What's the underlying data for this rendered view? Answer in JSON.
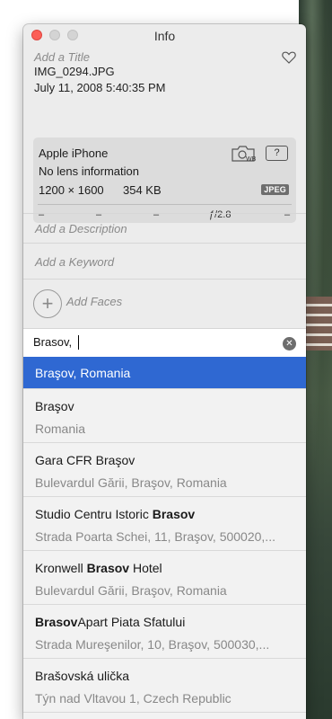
{
  "window": {
    "title": "Info"
  },
  "header": {
    "title_placeholder": "Add a Title",
    "filename": "IMG_0294.JPG",
    "datetime": "July 11, 2008   5:40:35 PM"
  },
  "camera": {
    "model": "Apple iPhone",
    "lens": "No lens information",
    "resolution": "1200 × 1600",
    "size": "354 KB",
    "format": "JPEG",
    "help": "?",
    "exif": [
      "–",
      "–",
      "–",
      "ƒ/2.8",
      "–"
    ]
  },
  "fields": {
    "description_placeholder": "Add a Description",
    "keyword_placeholder": "Add a Keyword",
    "faces_label": "Add Faces"
  },
  "location": {
    "value": "Brasov,"
  },
  "results": [
    {
      "main": "Braşov, Romania",
      "sub": ""
    },
    {
      "main": "Braşov",
      "sub": "Romania"
    },
    {
      "main": "Gara CFR Braşov",
      "sub": "Bulevardul Gării, Braşov, Romania"
    },
    {
      "main_prefix": "Studio Centru Istoric ",
      "main_bold": "Brasov",
      "main_suffix": "",
      "sub": "Strada Poarta Schei, 11, Braşov, 500020,..."
    },
    {
      "main_prefix": "Kronwell ",
      "main_bold": "Brasov",
      "main_suffix": " Hotel",
      "sub": "Bulevardul Gării, Braşov, Romania"
    },
    {
      "main_prefix": "",
      "main_bold": "Brasov",
      "main_suffix": "Apart Piata Sfatului",
      "sub": "Strada Mureşenilor, 10, Braşov, 500030,..."
    },
    {
      "main": "Brašovská ulička",
      "sub": "Týn nad Vltavou 1, Czech Republic"
    }
  ],
  "colors": {
    "selection": "#2f68d2",
    "close": "#fc5f57"
  }
}
